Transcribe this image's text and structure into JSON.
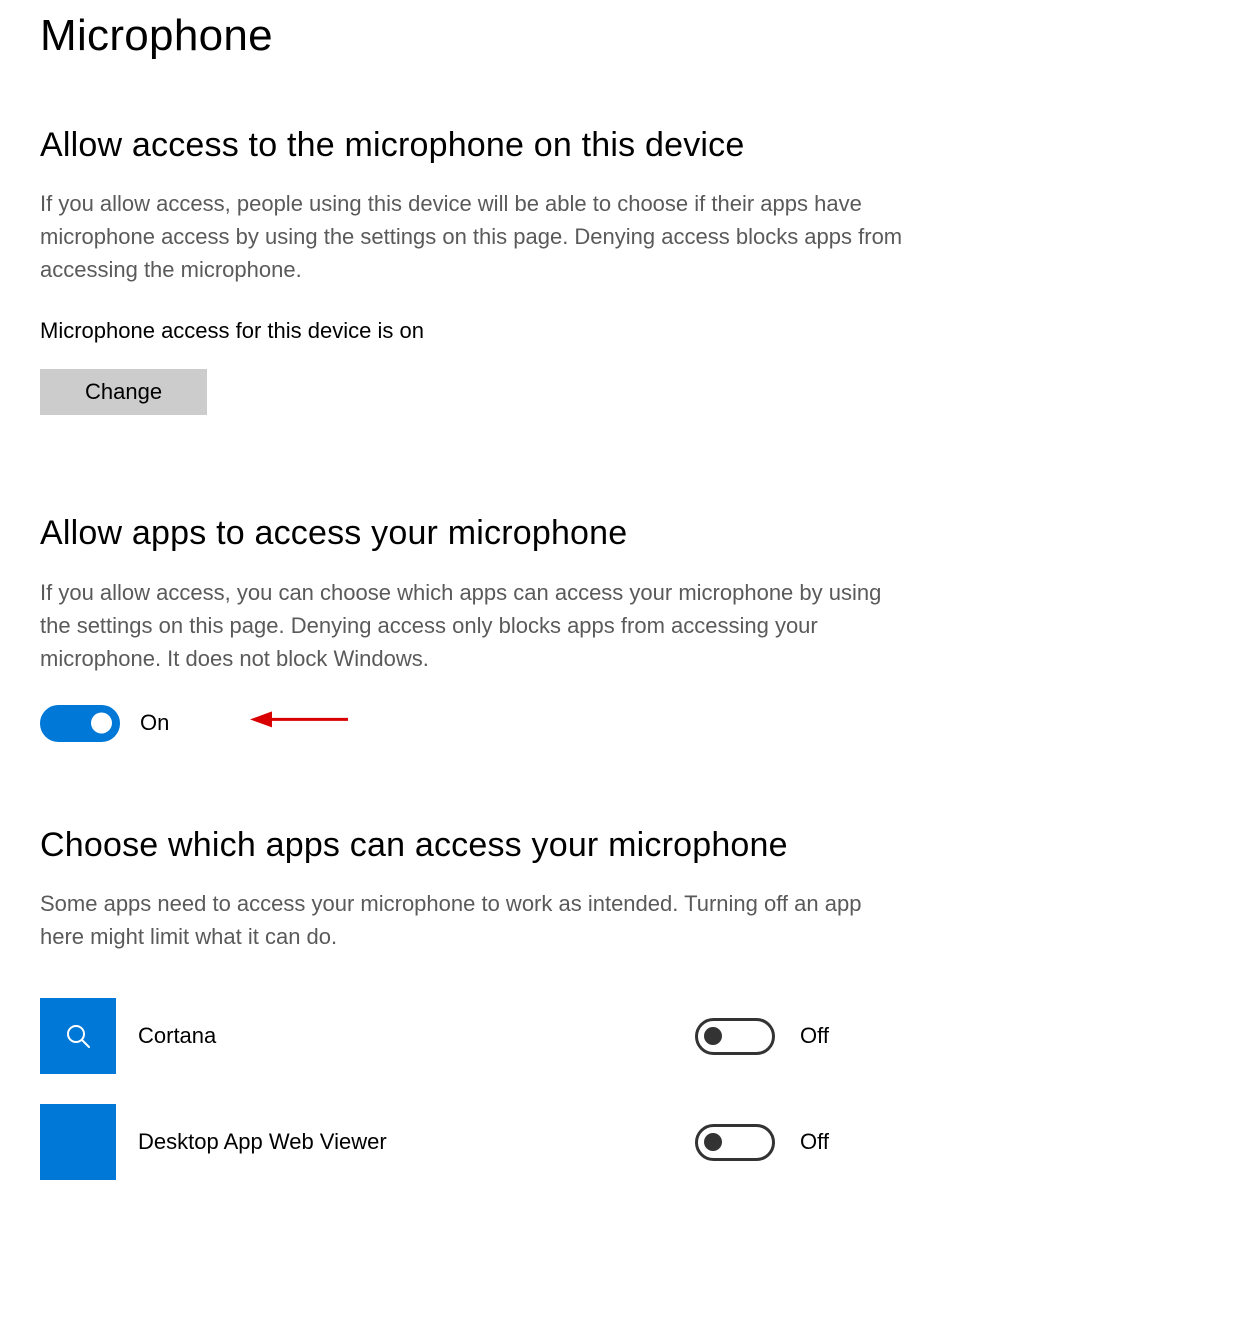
{
  "page": {
    "title": "Microphone"
  },
  "section1": {
    "heading": "Allow access to the microphone on this device",
    "desc": "If you allow access, people using this device will be able to choose if their apps have microphone access by using the settings on this page. Denying access blocks apps from accessing the microphone.",
    "status": "Microphone access for this device is on",
    "button": "Change"
  },
  "section2": {
    "heading": "Allow apps to access your microphone",
    "desc": "If you allow access, you can choose which apps can access your microphone by using the settings on this page. Denying access only blocks apps from accessing your microphone. It does not block Windows.",
    "toggle_state": "On"
  },
  "section3": {
    "heading": "Choose which apps can access your microphone",
    "desc": "Some apps need to access your microphone to work as intended. Turning off an app here might limit what it can do.",
    "apps": [
      {
        "name": "Cortana",
        "state": "Off"
      },
      {
        "name": "Desktop App Web Viewer",
        "state": "Off"
      }
    ]
  }
}
